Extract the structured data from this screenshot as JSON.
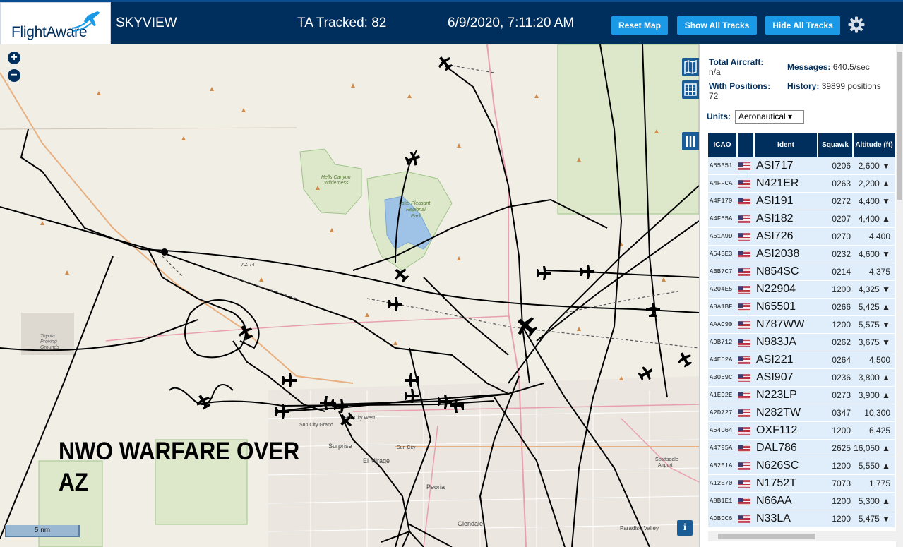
{
  "header": {
    "logo_text": "FlightAware",
    "app_name": "SKYVIEW",
    "tracked": "TA Tracked: 82",
    "clock": "6/9/2020, 7:11:20 AM",
    "reset_label": "Reset Map",
    "show_label": "Show All Tracks",
    "hide_label": "Hide All Tracks",
    "settings_icon": "gear-icon",
    "colors": {
      "bar": "#002f5d",
      "button": "#1a9ae6"
    }
  },
  "map": {
    "zoom_in": "+",
    "zoom_out": "−",
    "overlay_line1": "NWO WARFARE OVER",
    "overlay_line2": "AZ",
    "scale": "5 nm",
    "info": "i",
    "labels": {
      "hells_canyon": "Hells Canyon",
      "wilderness": "Wilderness",
      "lake_pleasant": "Lake Pleasant",
      "regional": "Regional",
      "park": "Park",
      "toyota1": "Toyota",
      "toyota2": "Proving",
      "toyota3": "Grounds",
      "surprise": "Surprise",
      "el_mirage": "El Mirage",
      "sun_city_grand": "Sun City Grand",
      "sun_city_west": "Sun City West",
      "sun_city": "Sun City",
      "peoria": "Peoria",
      "glendale": "Glendale",
      "paradise_valley": "Paradise Valley",
      "scottsdale1": "Scottsdale",
      "scottsdale2": "Airport",
      "az74": "AZ 74"
    }
  },
  "sidebar": {
    "total_label": "Total Aircraft:",
    "total_value": "n/a",
    "positions_label": "With Positions:",
    "positions_value": "72",
    "messages_label": "Messages:",
    "messages_value": "640.5/sec",
    "history_label": "History:",
    "history_value": "39899 positions",
    "units_label": "Units:",
    "units_value": "Aeronautical ▾"
  },
  "table": {
    "headers": {
      "icao": "ICAO",
      "ident": "Ident",
      "squawk": "Squawk",
      "altitude": "Altitude (ft)"
    },
    "rows": [
      {
        "icao": "A55351",
        "ident": "ASI717",
        "squawk": "0206",
        "alt": "2,600 ▼"
      },
      {
        "icao": "A4FFCA",
        "ident": "N421ER",
        "squawk": "0263",
        "alt": "2,200 ▲"
      },
      {
        "icao": "A4F179",
        "ident": "ASI191",
        "squawk": "0272",
        "alt": "4,400 ▼"
      },
      {
        "icao": "A4F55A",
        "ident": "ASI182",
        "squawk": "0207",
        "alt": "4,400 ▲"
      },
      {
        "icao": "A51A9D",
        "ident": "ASI726",
        "squawk": "0270",
        "alt": "4,400"
      },
      {
        "icao": "A54BE3",
        "ident": "ASI2038",
        "squawk": "0232",
        "alt": "4,600 ▼"
      },
      {
        "icao": "ABB7C7",
        "ident": "N854SC",
        "squawk": "0214",
        "alt": "4,375"
      },
      {
        "icao": "A204E5",
        "ident": "N22904",
        "squawk": "1200",
        "alt": "4,325 ▼"
      },
      {
        "icao": "A8A1BF",
        "ident": "N65501",
        "squawk": "0266",
        "alt": "5,425 ▲"
      },
      {
        "icao": "AAAC90",
        "ident": "N787WW",
        "squawk": "1200",
        "alt": "5,575 ▼"
      },
      {
        "icao": "ADB712",
        "ident": "N983JA",
        "squawk": "0262",
        "alt": "3,675 ▼"
      },
      {
        "icao": "A4E62A",
        "ident": "ASI221",
        "squawk": "0264",
        "alt": "4,500"
      },
      {
        "icao": "A3059C",
        "ident": "ASI907",
        "squawk": "0236",
        "alt": "3,800 ▲"
      },
      {
        "icao": "A1ED2E",
        "ident": "N223LP",
        "squawk": "0273",
        "alt": "3,900 ▲"
      },
      {
        "icao": "A2D727",
        "ident": "N282TW",
        "squawk": "0347",
        "alt": "10,300"
      },
      {
        "icao": "A54D64",
        "ident": "OXF112",
        "squawk": "1200",
        "alt": "6,425"
      },
      {
        "icao": "A4795A",
        "ident": "DAL786",
        "squawk": "2625",
        "alt": "16,050 ▲"
      },
      {
        "icao": "A82E1A",
        "ident": "N626SC",
        "squawk": "1200",
        "alt": "5,550 ▲"
      },
      {
        "icao": "A12E70",
        "ident": "N1752T",
        "squawk": "7073",
        "alt": "1,775"
      },
      {
        "icao": "A8B1E1",
        "ident": "N66AA",
        "squawk": "1200",
        "alt": "5,300 ▲"
      },
      {
        "icao": "ADBDC6",
        "ident": "N33LA",
        "squawk": "1200",
        "alt": "5,475 ▼"
      }
    ]
  }
}
